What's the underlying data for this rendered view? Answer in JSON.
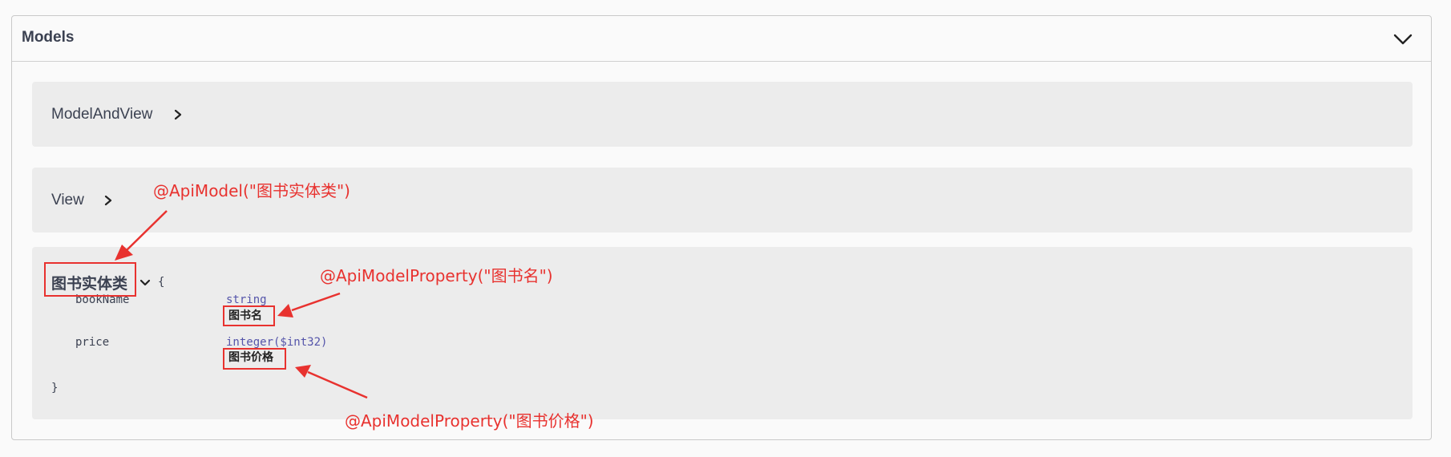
{
  "models": {
    "title": "Models",
    "items": [
      {
        "name": "ModelAndView"
      },
      {
        "name": "View"
      }
    ],
    "entity": {
      "title": "图书实体类",
      "open_brace": "{",
      "close_brace": "}",
      "properties": [
        {
          "name": "bookName",
          "type": "string",
          "description": "图书名"
        },
        {
          "name": "price",
          "type": "integer($int32)",
          "description": "图书价格"
        }
      ]
    }
  },
  "annotations": {
    "api_model": "@ApiModel(\"图书实体类\")",
    "prop_book_name": "@ApiModelProperty(\"图书名\")",
    "prop_price": "@ApiModelProperty(\"图书价格\")"
  },
  "colors": {
    "annotation": "#e8322f",
    "text": "#3b4151",
    "type": "#5555aa",
    "model_box": "#ececec"
  }
}
